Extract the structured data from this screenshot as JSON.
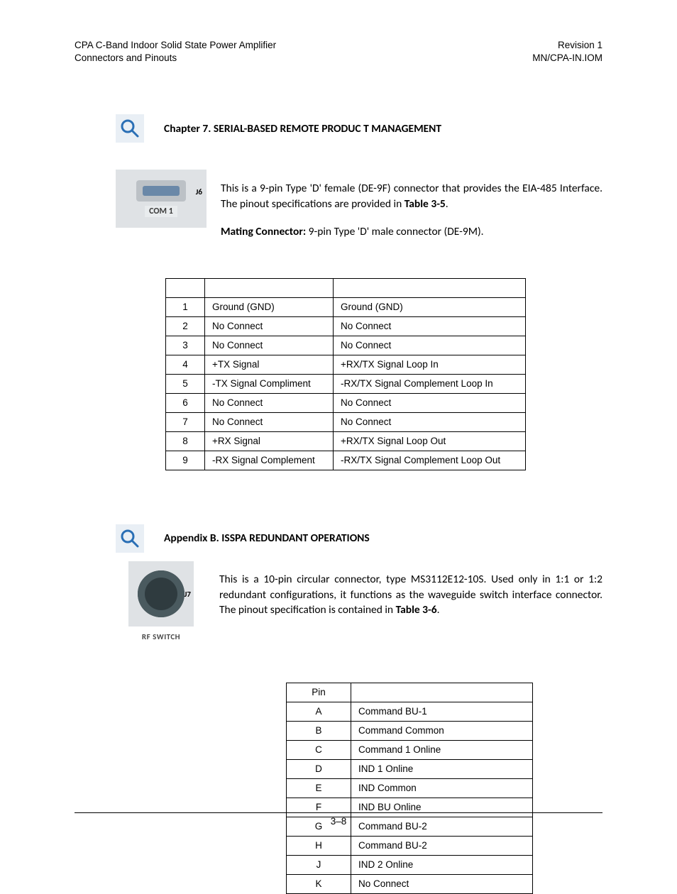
{
  "header": {
    "left_line1": "CPA C-Band Indoor Solid State Power Amplifier",
    "left_line2": "Connectors and Pinouts",
    "right_line1": "Revision 1",
    "right_line2": "MN/CPA-IN.IOM"
  },
  "chapter7": {
    "title": "Chapter 7. SERIAL-BASED REMOTE PRODUC T MANAGEMENT",
    "connector_label": "COM 1",
    "connector_tag": "J6",
    "para1_a": "This is a 9-pin Type 'D' female (DE-9F) connector that provides the EIA-485 Interface. The pinout specifications are provided in ",
    "para1_b_bold": "Table 3-5",
    "para1_c": ".",
    "para2_label": "Mating Connector:",
    "para2_rest": " 9-pin Type 'D' male connector (DE-9M).",
    "table": {
      "rows": [
        {
          "pin": "1",
          "c2": "Ground (GND)",
          "c3": "Ground (GND)"
        },
        {
          "pin": "2",
          "c2": "No Connect",
          "c3": "No Connect"
        },
        {
          "pin": "3",
          "c2": "No Connect",
          "c3": "No Connect"
        },
        {
          "pin": "4",
          "c2": "+TX Signal",
          "c3": "+RX/TX Signal Loop In"
        },
        {
          "pin": "5",
          "c2": "-TX Signal Compliment",
          "c3": "-RX/TX Signal Complement Loop In"
        },
        {
          "pin": "6",
          "c2": "No Connect",
          "c3": "No Connect"
        },
        {
          "pin": "7",
          "c2": "No Connect",
          "c3": "No Connect"
        },
        {
          "pin": "8",
          "c2": "+RX Signal",
          "c3": "+RX/TX Signal Loop Out"
        },
        {
          "pin": "9",
          "c2": "-RX Signal Complement",
          "c3": "-RX/TX Signal Complement Loop Out"
        }
      ]
    }
  },
  "appendixB": {
    "title": "Appendix B. ISSPA REDUNDANT OPERATIONS",
    "connector_label": "RF SWITCH",
    "connector_tag": "J7",
    "para_a": "This is a 10-pin circular connector, type MS3112E12-10S. Used only in 1:1 or 1:2 redundant configurations, it functions as the waveguide switch interface connector. The pinout specification is contained in ",
    "para_b_bold": "Table 3-6",
    "para_c": ".",
    "table": {
      "header": "Pin",
      "rows": [
        {
          "pin": "A",
          "name": "Command BU-1"
        },
        {
          "pin": "B",
          "name": "Command Common"
        },
        {
          "pin": "C",
          "name": "Command 1 Online"
        },
        {
          "pin": "D",
          "name": "IND 1 Online"
        },
        {
          "pin": "E",
          "name": "IND Common"
        },
        {
          "pin": "F",
          "name": "IND BU Online"
        },
        {
          "pin": "G",
          "name": "Command BU-2"
        },
        {
          "pin": "H",
          "name": "Command BU-2"
        },
        {
          "pin": "J",
          "name": "IND 2 Online"
        },
        {
          "pin": "K",
          "name": "No Connect"
        }
      ]
    }
  },
  "footer": {
    "page_number": "3–8"
  }
}
